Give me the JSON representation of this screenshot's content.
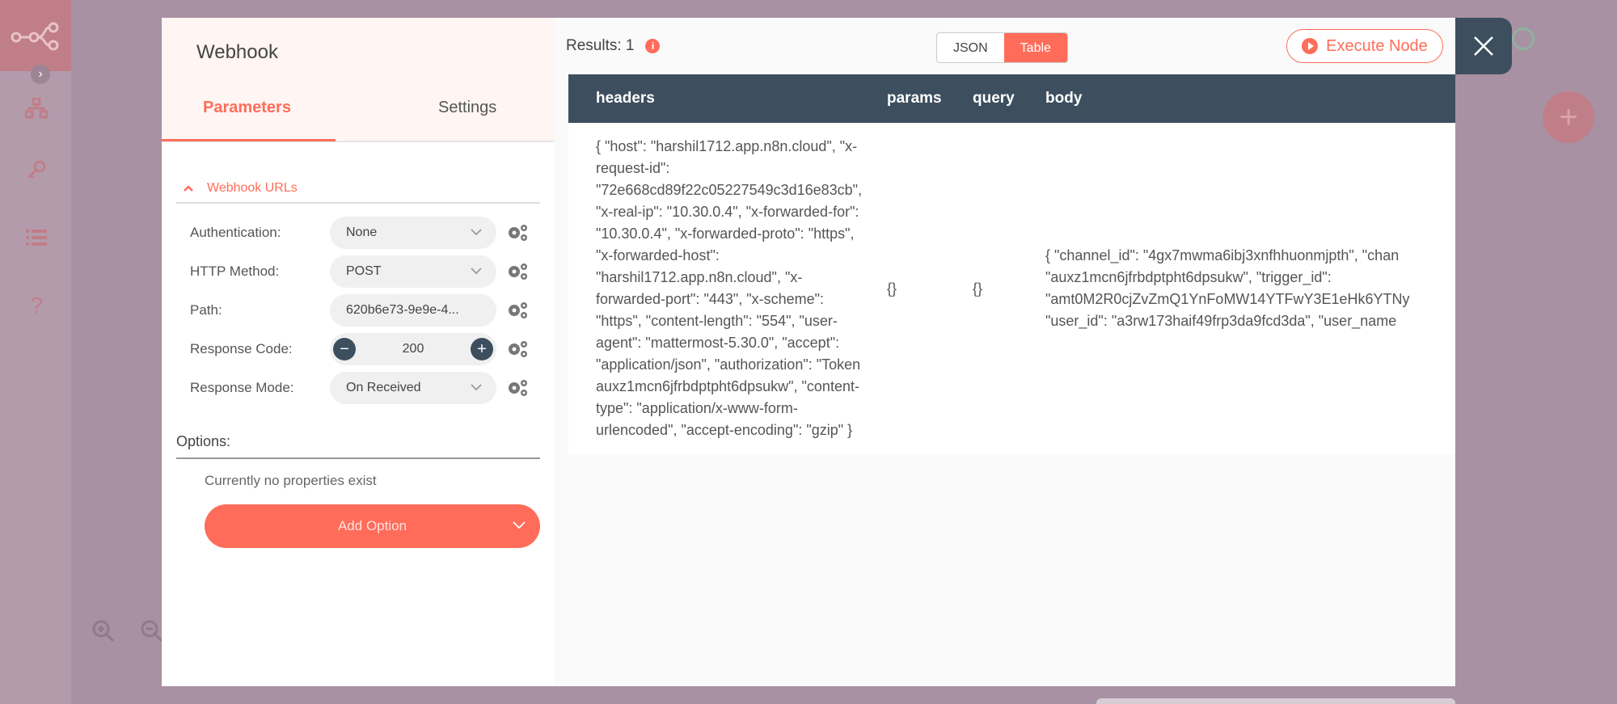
{
  "background": {
    "icons": [
      "workflow-logo-icon",
      "expand-chevron-icon",
      "network-icon",
      "key-icon",
      "list-icon",
      "help-icon",
      "zoom-in-icon",
      "zoom-out-icon",
      "add-node-icon"
    ]
  },
  "node": {
    "title": "Webhook",
    "tabs": [
      "Parameters",
      "Settings"
    ]
  },
  "webhook_urls": {
    "label": "Webhook URLs"
  },
  "fields": [
    {
      "label": "Authentication:",
      "value": "None"
    },
    {
      "label": "HTTP Method:",
      "value": "POST"
    },
    {
      "label": "Path:",
      "value": "620b6e73-9e9e-4..."
    },
    {
      "label": "Response Code:",
      "value": "200"
    },
    {
      "label": "Response Mode:",
      "value": "On Received"
    }
  ],
  "options": {
    "label": "Options:",
    "empty_text": "Currently no properties exist",
    "add_button": "Add Option"
  },
  "output": {
    "results": "Results: 1",
    "view_modes": [
      "JSON",
      "Table"
    ],
    "active_view": "Table",
    "execute_button": "Execute Node",
    "columns": [
      "headers",
      "params",
      "query",
      "body"
    ],
    "row": {
      "headers": "{ \"host\": \"harshil1712.app.n8n.cloud\", \"x-request-id\": \"72e668cd89f22c05227549c3d16e83cb\", \"x-real-ip\": \"10.30.0.4\", \"x-forwarded-for\": \"10.30.0.4\", \"x-forwarded-proto\": \"https\", \"x-forwarded-host\": \"harshil1712.app.n8n.cloud\", \"x-forwarded-port\": \"443\", \"x-scheme\": \"https\", \"content-length\": \"554\", \"user-agent\": \"mattermost-5.30.0\", \"accept\": \"application/json\", \"authorization\": \"Token auxz1mcn6jfrbdptpht6dpsukw\", \"content-type\": \"application/x-www-form-urlencoded\", \"accept-encoding\": \"gzip\" }",
      "params": "{}",
      "query": "{}",
      "body": "{ \"channel_id\": \"4gx7mwma6ibj3xnfhhuonmjpth\", \"chan\n\"auxz1mcn6jfrbdptpht6dpsukw\", \"trigger_id\":\n\"amt0M2R0cjZvZmQ1YnFoMW14YTFwY3E1eHk6YTNy\n\"user_id\": \"a3rw173haif49frp3da9fcd3da\", \"user_name"
    }
  },
  "colors": {
    "accent": "#ff6d5a",
    "header_dark": "#3d4f5e",
    "overlay": "#a891a2"
  }
}
